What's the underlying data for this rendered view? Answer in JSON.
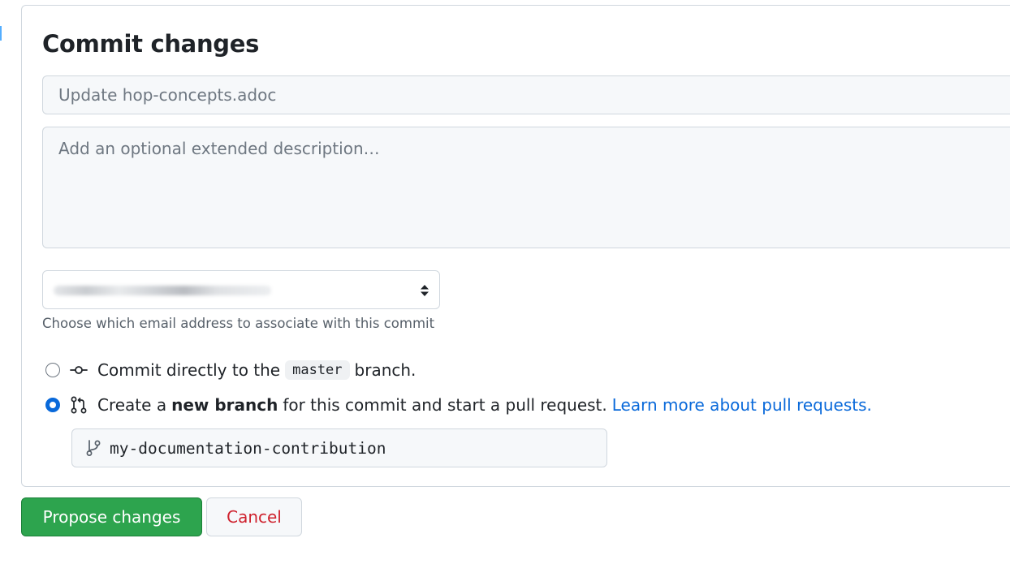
{
  "panel": {
    "title": "Commit changes"
  },
  "commit_form": {
    "summary_placeholder": "Update hop-concepts.adoc",
    "description_placeholder": "Add an optional extended description…",
    "email_hint": "Choose which email address to associate with this commit"
  },
  "commit_options": {
    "direct": {
      "prefix": "Commit directly to the",
      "branch": "master",
      "suffix": "branch.",
      "selected": false
    },
    "new_branch": {
      "prefix": "Create a",
      "bold": "new branch",
      "suffix": "for this commit and start a pull request.",
      "link_text": "Learn more about pull requests.",
      "selected": true
    }
  },
  "branch_name": {
    "value": "my-documentation-contribution"
  },
  "actions": {
    "propose_label": "Propose changes",
    "cancel_label": "Cancel"
  },
  "colors": {
    "primary_button": "#2da44e",
    "link": "#0969da",
    "danger_text": "#cf222e",
    "radio_selected": "#0969da"
  },
  "icons": {
    "direct_commit": "git-commit-icon",
    "new_branch": "git-pull-request-icon",
    "branch_field": "git-branch-icon",
    "select": "select-arrows-icon"
  }
}
